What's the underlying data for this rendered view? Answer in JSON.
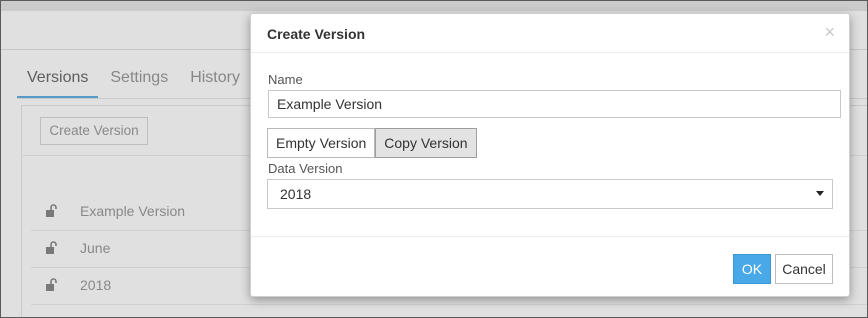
{
  "tabs": [
    {
      "label": "Versions",
      "active": true
    },
    {
      "label": "Settings",
      "active": false
    },
    {
      "label": "History",
      "active": false
    }
  ],
  "background": {
    "create_button_label": "Create Version",
    "versions": [
      {
        "name": "Example Version",
        "icon": "unlock-icon"
      },
      {
        "name": "June",
        "icon": "unlock-icon"
      },
      {
        "name": "2018",
        "icon": "unlock-icon"
      }
    ]
  },
  "dialog": {
    "title": "Create Version",
    "close_glyph": "×",
    "name_label": "Name",
    "name_value": "Example Version",
    "segments": [
      {
        "label": "Empty Version",
        "selected": false
      },
      {
        "label": "Copy Version",
        "selected": true
      }
    ],
    "data_version_label": "Data Version",
    "data_version_value": "2018",
    "ok_label": "OK",
    "cancel_label": "Cancel"
  },
  "colors": {
    "accent": "#49a9e8",
    "tab_underline": "#64b2e5"
  }
}
